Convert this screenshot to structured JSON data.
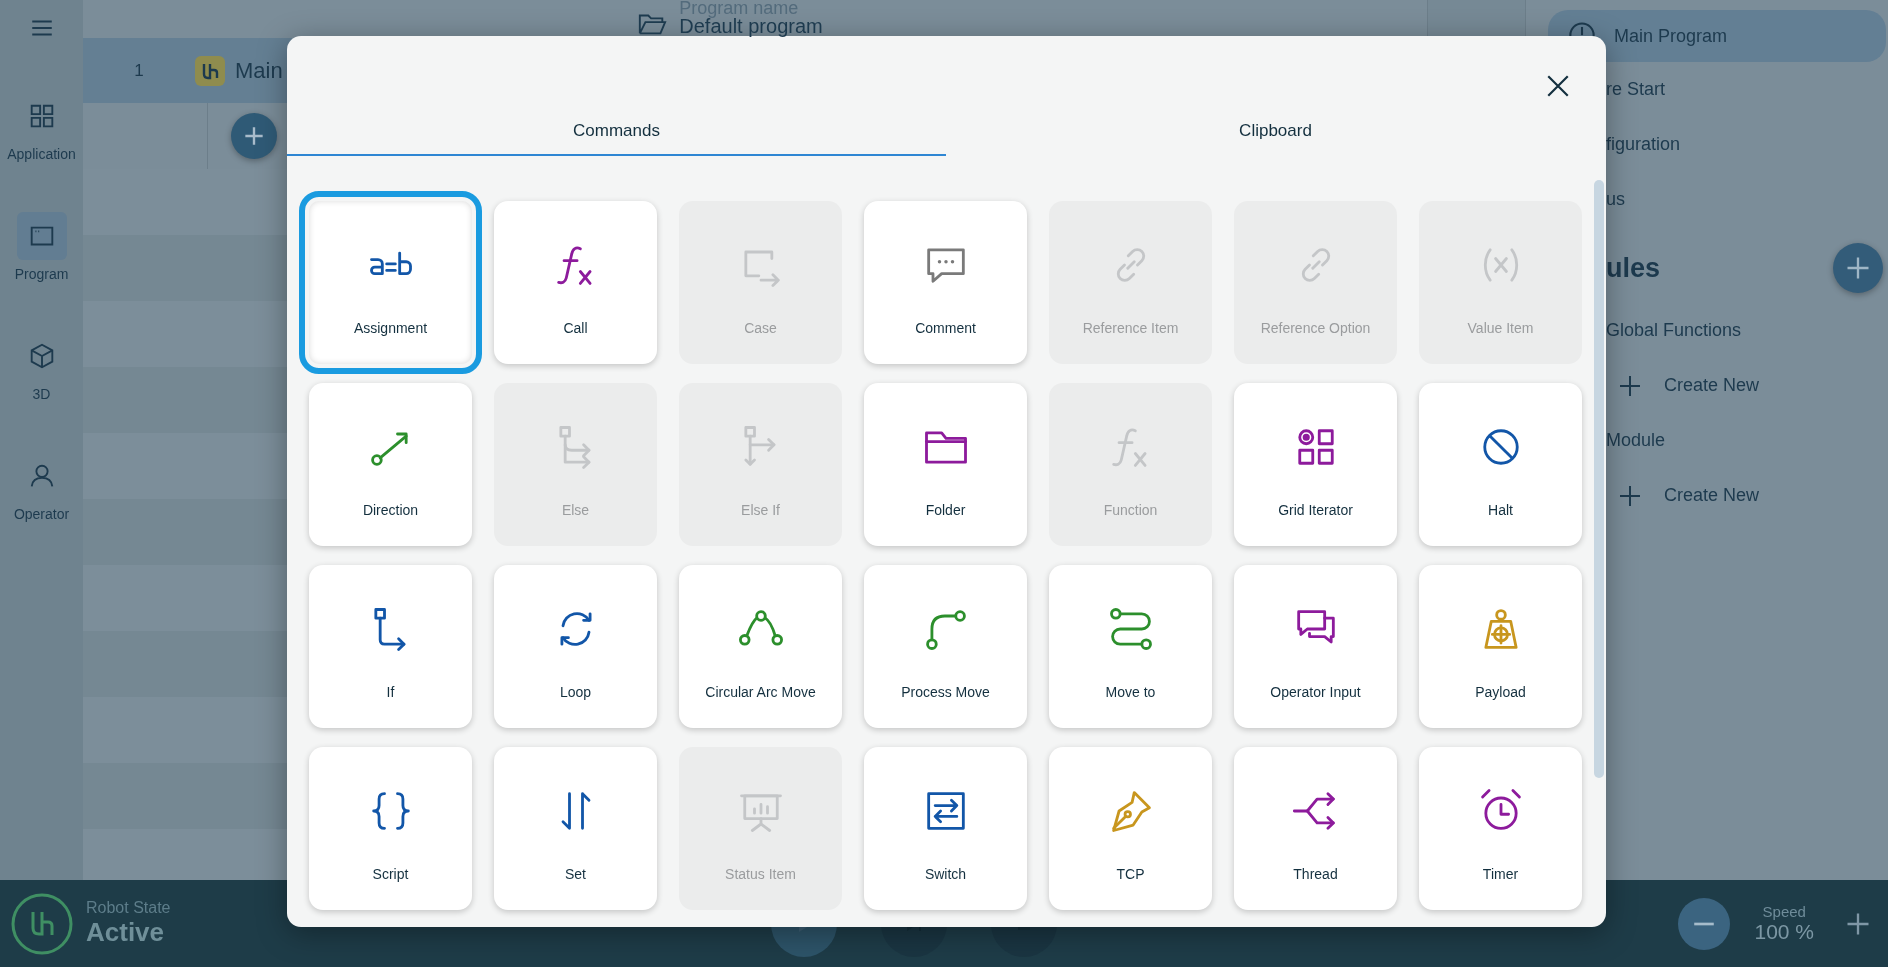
{
  "sidebar": {
    "items": [
      {
        "label": "Application",
        "selected": false
      },
      {
        "label": "Program",
        "selected": true
      },
      {
        "label": "3D",
        "selected": false
      },
      {
        "label": "Operator",
        "selected": false
      }
    ]
  },
  "header": {
    "program_label": "Program name",
    "program_name": "Default program"
  },
  "program_tree": {
    "rows": [
      {
        "line": "1",
        "name": "Main",
        "selected": true
      }
    ]
  },
  "right_panel": {
    "items": [
      {
        "label": "Main Program",
        "selected": true
      },
      {
        "label": "re Start",
        "selected": false
      },
      {
        "label": "figuration",
        "selected": false
      },
      {
        "label": "us",
        "selected": false
      }
    ],
    "section_title": "ules",
    "groups": [
      {
        "label": "Global Functions",
        "action": "Create New"
      },
      {
        "label": "Module",
        "action": "Create New"
      }
    ]
  },
  "dialog": {
    "tabs": [
      {
        "label": "Commands",
        "selected": true
      },
      {
        "label": "Clipboard",
        "selected": false
      }
    ],
    "commands": [
      {
        "label": "Assignment",
        "color": "#1256a8",
        "disabled": false,
        "selected": true
      },
      {
        "label": "Call",
        "color": "#8d1b9c",
        "disabled": false,
        "selected": false
      },
      {
        "label": "Case",
        "color": "#c4c6c8",
        "disabled": true,
        "selected": false
      },
      {
        "label": "Comment",
        "color": "#7a7a7a",
        "disabled": false,
        "selected": false
      },
      {
        "label": "Reference Item",
        "color": "#c4c6c8",
        "disabled": true,
        "selected": false
      },
      {
        "label": "Reference Option",
        "color": "#c4c6c8",
        "disabled": true,
        "selected": false
      },
      {
        "label": "Value Item",
        "color": "#c4c6c8",
        "disabled": true,
        "selected": false
      },
      {
        "label": "Direction",
        "color": "#2c8f2c",
        "disabled": false,
        "selected": false
      },
      {
        "label": "Else",
        "color": "#c4c6c8",
        "disabled": true,
        "selected": false
      },
      {
        "label": "Else If",
        "color": "#c4c6c8",
        "disabled": true,
        "selected": false
      },
      {
        "label": "Folder",
        "color": "#8d1b9c",
        "disabled": false,
        "selected": false
      },
      {
        "label": "Function",
        "color": "#c4c6c8",
        "disabled": true,
        "selected": false
      },
      {
        "label": "Grid Iterator",
        "color": "#8d1b9c",
        "disabled": false,
        "selected": false
      },
      {
        "label": "Halt",
        "color": "#1256a8",
        "disabled": false,
        "selected": false
      },
      {
        "label": "If",
        "color": "#1256a8",
        "disabled": false,
        "selected": false
      },
      {
        "label": "Loop",
        "color": "#1256a8",
        "disabled": false,
        "selected": false
      },
      {
        "label": "Circular Arc Move",
        "color": "#2c8f2c",
        "disabled": false,
        "selected": false
      },
      {
        "label": "Process Move",
        "color": "#2c8f2c",
        "disabled": false,
        "selected": false
      },
      {
        "label": "Move to",
        "color": "#2c8f2c",
        "disabled": false,
        "selected": false
      },
      {
        "label": "Operator Input",
        "color": "#8d1b9c",
        "disabled": false,
        "selected": false
      },
      {
        "label": "Payload",
        "color": "#c8961e",
        "disabled": false,
        "selected": false
      },
      {
        "label": "Script",
        "color": "#1256a8",
        "disabled": false,
        "selected": false
      },
      {
        "label": "Set",
        "color": "#1256a8",
        "disabled": false,
        "selected": false
      },
      {
        "label": "Status Item",
        "color": "#c4c6c8",
        "disabled": true,
        "selected": false
      },
      {
        "label": "Switch",
        "color": "#1256a8",
        "disabled": false,
        "selected": false
      },
      {
        "label": "TCP",
        "color": "#c8961e",
        "disabled": false,
        "selected": false
      },
      {
        "label": "Thread",
        "color": "#8d1b9c",
        "disabled": false,
        "selected": false
      },
      {
        "label": "Timer",
        "color": "#8d1b9c",
        "disabled": false,
        "selected": false
      }
    ]
  },
  "status_bar": {
    "robot_state_label": "Robot State",
    "robot_state": "Active",
    "speed_label": "Speed",
    "speed": "100 %"
  }
}
